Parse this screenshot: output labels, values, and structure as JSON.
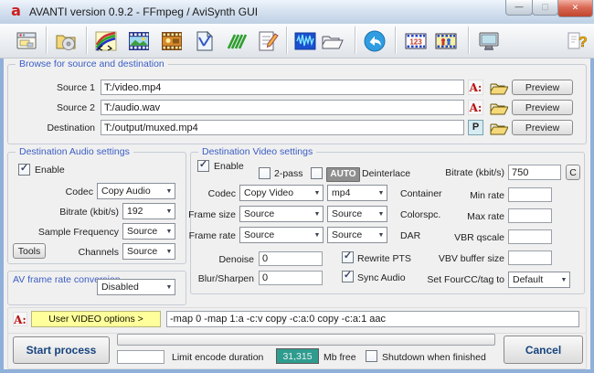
{
  "window": {
    "title": "AVANTI version 0.9.2 - FFmpeg / AviSynth GUI",
    "logo_letter": "a"
  },
  "glyphs": {
    "checkmark": "✓",
    "dropdown_arrow": "▼",
    "minimize": "—",
    "maximize": "▢",
    "close": "✕"
  },
  "toolbar": {
    "icons": [
      "app-window",
      "folder-cd",
      "color-curves",
      "filmstrip-picture",
      "filmstrip-video",
      "document-letter",
      "avisynth-zigzag",
      "notepad-edit",
      "audio-spectrum",
      "folder-open",
      "undo-arrow",
      "frame-counter-123",
      "film-edit",
      "monitor",
      "help"
    ],
    "counter_icon_text": "123",
    "document_icon_letter": "A",
    "help_icon_text": "?"
  },
  "browse": {
    "title": "Browse for source and destination",
    "source1_label": "Source 1",
    "source1_value": "T:/video.mp4",
    "source2_label": "Source 2",
    "source2_value": "T:/audio.wav",
    "dest_label": "Destination",
    "dest_value": "T:/output/muxed.mp4",
    "avs_button_label": "A:",
    "p_button_label": "P",
    "preview_label": "Preview"
  },
  "audio": {
    "title": "Destination Audio settings",
    "enable_label": "Enable",
    "codec_label": "Codec",
    "codec_value": "Copy Audio",
    "bitrate_label": "Bitrate (kbit/s)",
    "bitrate_value": "192",
    "samplefreq_label": "Sample Frequency",
    "samplefreq_value": "Source",
    "tools_label": "Tools",
    "channels_label": "Channels",
    "channels_value": "Source"
  },
  "avframe": {
    "label": "AV frame rate conversion",
    "value": "Disabled"
  },
  "video": {
    "title": "Destination Video settings",
    "enable_label": "Enable",
    "twopass_label": "2-pass",
    "auto_label": "AUTO",
    "deinterlace_label": "Deinterlace",
    "bitrate_label": "Bitrate (kbit/s)",
    "bitrate_value": "750",
    "c_button_label": "C",
    "codec_label": "Codec",
    "codec_value": "Copy Video",
    "container_value": "mp4",
    "container_label": "Container",
    "minrate_label": "Min rate",
    "minrate_value": "",
    "framesize_label": "Frame size",
    "framesize_value": "Source",
    "framesize2_value": "Source",
    "colorspc_label": "Colorspc.",
    "maxrate_label": "Max rate",
    "maxrate_value": "",
    "framerate_label": "Frame rate",
    "framerate_value": "Source",
    "framerate2_value": "Source",
    "dar_label": "DAR",
    "vbrqscale_label": "VBR qscale",
    "vbrqscale_value": "",
    "denoise_label": "Denoise",
    "denoise_value": "0",
    "rewritepts_label": "Rewrite PTS",
    "vbv_label": "VBV buffer size",
    "vbv_value": "",
    "blursharpen_label": "Blur/Sharpen",
    "blursharpen_value": "0",
    "syncaudio_label": "Sync Audio",
    "fourcc_label": "Set FourCC/tag to",
    "fourcc_value": "Default"
  },
  "useropts": {
    "avs_button_label": "A:",
    "label": "User VIDEO options >",
    "value": "-map 0 -map 1:a -c:v copy -c:a:0 copy -c:a:1 aac"
  },
  "bottom": {
    "start_label": "Start process",
    "limit_value": "",
    "limit_label": "Limit encode duration",
    "mbfree_value": "31,315",
    "mbfree_label": "Mb free",
    "shutdown_label": "Shutdown when finished",
    "cancel_label": "Cancel"
  },
  "colors": {
    "group_title_blue": "#3a5dc4",
    "teal": "#2e9c8f",
    "yellow": "#ffff9c",
    "logo_red": "#cc1f1f",
    "button_text_blue": "#16437e"
  }
}
